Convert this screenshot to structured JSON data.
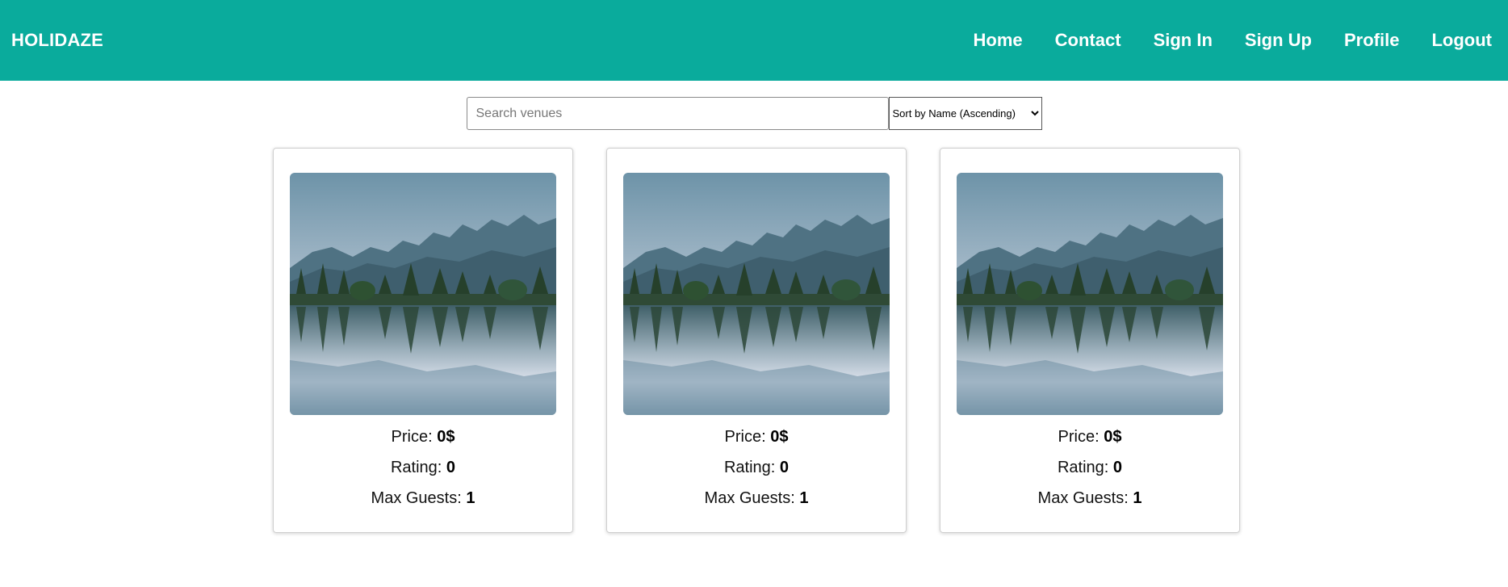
{
  "header": {
    "brand": "HOLIDAZE",
    "nav": [
      "Home",
      "Contact",
      "Sign In",
      "Sign Up",
      "Profile",
      "Logout"
    ]
  },
  "controls": {
    "search_placeholder": "Search venues",
    "search_value": "",
    "sort_selected": "Sort by Name (Ascending)"
  },
  "venues": [
    {
      "image": "mountain-lake-photo",
      "price_label": "Price:",
      "price_value": "0$",
      "rating_label": "Rating:",
      "rating_value": "0",
      "guests_label": "Max Guests:",
      "guests_value": "1"
    },
    {
      "image": "mountain-lake-photo",
      "price_label": "Price:",
      "price_value": "0$",
      "rating_label": "Rating:",
      "rating_value": "0",
      "guests_label": "Max Guests:",
      "guests_value": "1"
    },
    {
      "image": "mountain-lake-photo",
      "price_label": "Price:",
      "price_value": "0$",
      "rating_label": "Rating:",
      "rating_value": "0",
      "guests_label": "Max Guests:",
      "guests_value": "1"
    }
  ],
  "colors": {
    "header_bg": "#0aab9c",
    "header_text": "#ffffff"
  }
}
